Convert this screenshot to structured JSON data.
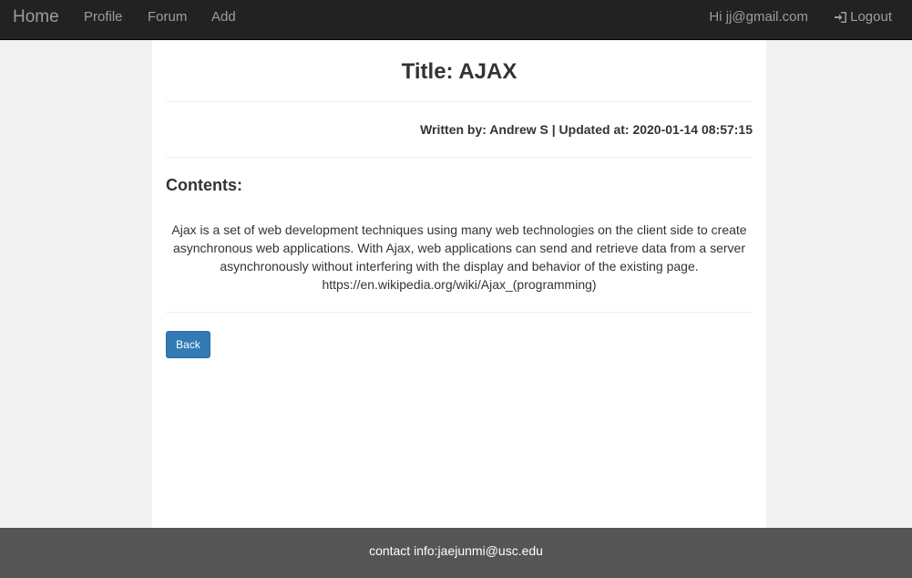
{
  "navbar": {
    "brand": "Home",
    "links": [
      "Profile",
      "Forum",
      "Add"
    ],
    "greeting": "Hi jj@gmail.com",
    "logout_label": "Logout",
    "logout_icon": "log-in-icon"
  },
  "post": {
    "title": "Title: AJAX",
    "meta": "Written by: Andrew S | Updated at: 2020-01-14 08:57:15",
    "contents_heading": "Contents:",
    "body_lines": [
      "Ajax is a set of web development techniques using many web technologies on the client side to create",
      "asynchronous web applications. With Ajax, web applications can send and retrieve data from a server",
      "asynchronously without interfering with the display and behavior of the existing page.",
      "https://en.wikipedia.org/wiki/Ajax_(programming)"
    ],
    "back_label": "Back"
  },
  "footer": {
    "text": "contact info:jaejunmi@usc.edu"
  },
  "colors": {
    "navbar_bg": "#222222",
    "nav_text": "#9d9d9d",
    "button_primary": "#337ab7",
    "footer_bg": "#555555",
    "page_bg": "#f2f2f2"
  }
}
